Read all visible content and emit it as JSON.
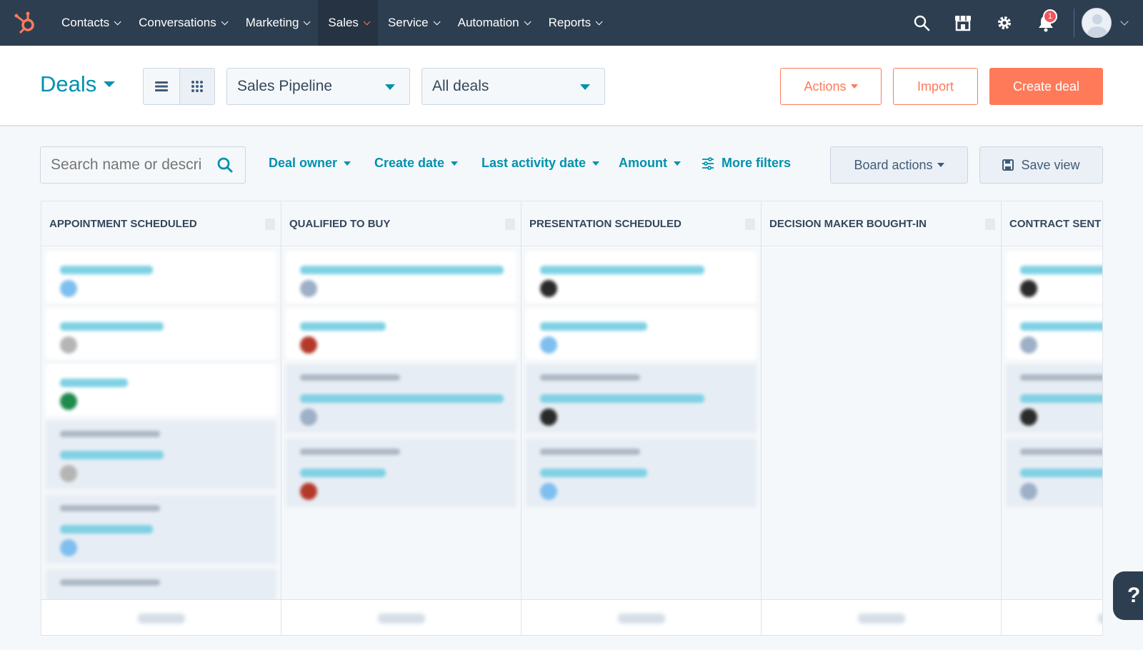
{
  "nav": {
    "items": [
      {
        "label": "Contacts",
        "active": false
      },
      {
        "label": "Conversations",
        "active": false
      },
      {
        "label": "Marketing",
        "active": false
      },
      {
        "label": "Sales",
        "active": true
      },
      {
        "label": "Service",
        "active": false
      },
      {
        "label": "Automation",
        "active": false
      },
      {
        "label": "Reports",
        "active": false
      }
    ],
    "notification_count": "1",
    "icons": [
      "search-icon",
      "marketplace-icon",
      "gear-icon",
      "bell-icon",
      "avatar-icon"
    ]
  },
  "header": {
    "title": "Deals",
    "pipeline": "Sales Pipeline",
    "view": "All deals",
    "actions_label": "Actions",
    "import_label": "Import",
    "create_label": "Create deal"
  },
  "filters": {
    "search_placeholder": "Search name or descri",
    "deal_owner": "Deal owner",
    "create_date": "Create date",
    "last_activity": "Last activity date",
    "amount": "Amount",
    "more_filters": "More filters",
    "board_actions": "Board actions",
    "save_view": "Save view"
  },
  "columns": [
    {
      "title": "APPOINTMENT SCHEDULED"
    },
    {
      "title": "QUALIFIED TO BUY"
    },
    {
      "title": "PRESENTATION SCHEDULED"
    },
    {
      "title": "DECISION MAKER BOUGHT-IN"
    },
    {
      "title": "CONTRACT SENT"
    }
  ],
  "colors": {
    "nav_bg": "#2d3e50",
    "accent": "#ff7a59",
    "link": "#0091ae"
  },
  "help_label": "?"
}
